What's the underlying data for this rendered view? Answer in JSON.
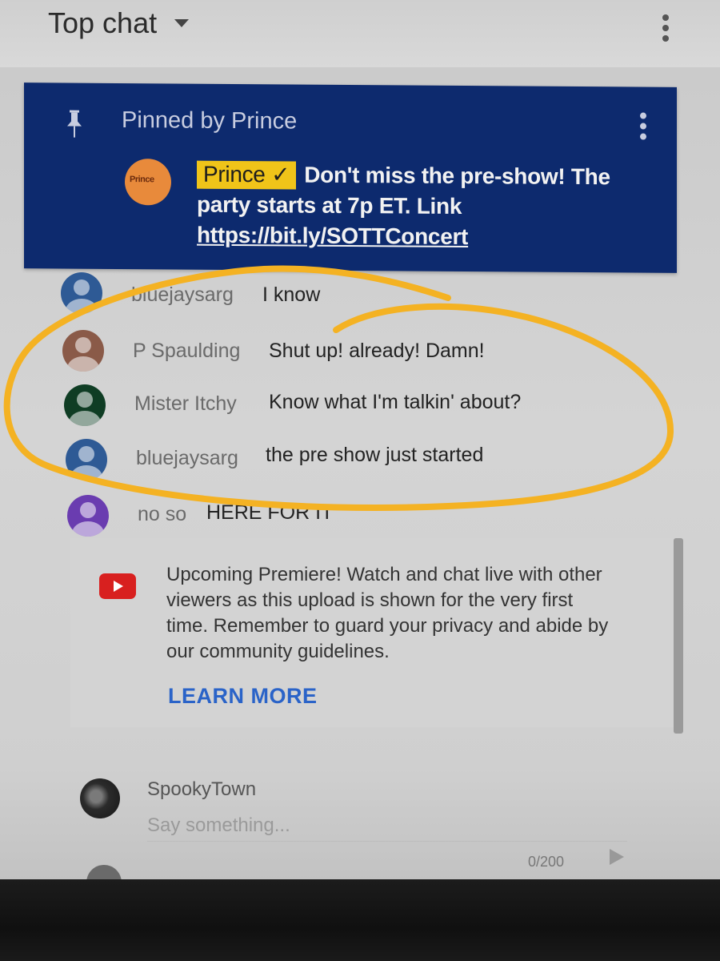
{
  "header": {
    "title": "Top chat"
  },
  "pinned": {
    "pinned_by": "Pinned by Prince",
    "avatar_logo": "Prince",
    "author": "Prince",
    "badge_check": "✓",
    "message": "Don't miss the pre-show! The party starts at 7p ET. Link ",
    "link": "https://bit.ly/SOTTConcert"
  },
  "chat": [
    {
      "author": "bluejaysarg",
      "message": "I know",
      "avatar_color": "#2e5a95"
    },
    {
      "author": "P Spaulding",
      "message": "Shut up! already! Damn!",
      "avatar_color": "#8a5a48"
    },
    {
      "author": "Mister Itchy",
      "message": "Know what I'm talkin' about?",
      "avatar_color": "#0f3d24"
    },
    {
      "author": "bluejaysarg",
      "message": "the pre show just started",
      "avatar_color": "#2e5a95"
    },
    {
      "author": "no so",
      "message": "HERE FOR IT",
      "avatar_color": "#6a3cb0"
    }
  ],
  "premiere": {
    "text": "Upcoming Premiere! Watch and chat live with other viewers as this upload is shown for the very first time. Remember to guard your privacy and abide by our community guidelines.",
    "learn_more": "LEARN MORE"
  },
  "composer": {
    "username": "SpookyTown",
    "placeholder": "Say something...",
    "char_count": "0/200"
  },
  "colors": {
    "pinned_bg": "#0d2a6e",
    "owner_badge": "#f0c419",
    "link_blue": "#2a63c8",
    "annotation_yellow": "#f4b223"
  }
}
